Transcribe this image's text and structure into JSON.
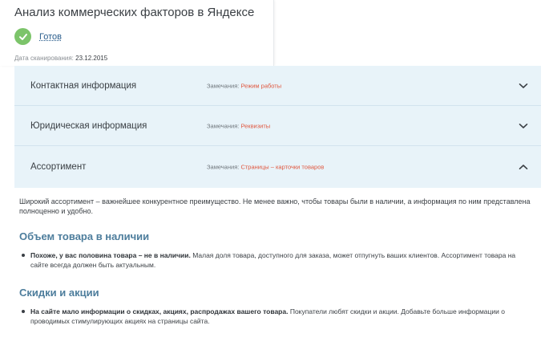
{
  "header": {
    "title": "Анализ коммерческих факторов в Яндексе",
    "status_label": "Готов",
    "status_icon": "check-circle-icon",
    "status_color": "#7cc46a",
    "scan_date_label": "Дата сканирования:",
    "scan_date_value": "23.12.2015"
  },
  "accordion": {
    "items": [
      {
        "label": "Контактная информация",
        "notes_label": "Замечания:",
        "notes_value": "Режим работы",
        "state": "collapsed",
        "chevron_icon": "chevron-down-icon"
      },
      {
        "label": "Юридическая информация",
        "notes_label": "Замечания:",
        "notes_value": "Реквизиты",
        "state": "collapsed",
        "chevron_icon": "chevron-down-icon"
      },
      {
        "label": "Ассортимент",
        "notes_label": "Замечания:",
        "notes_value": "Страницы – карточки товаров",
        "state": "expanded",
        "chevron_icon": "chevron-up-icon"
      }
    ]
  },
  "content": {
    "intro": "Широкий ассортимент – важнейшее конкурентное преимущество. Не менее важно, чтобы товары были в наличии, а информация по ним представлена полноценно и удобно.",
    "sections": [
      {
        "title": "Объем товара в наличии",
        "bullet_bold": "Похоже, у вас половина товара – не в наличии.",
        "bullet_text": " Малая доля товара, доступного для заказа, может отпугнуть ваших клиентов. Ассортимент товара на сайте всегда должен быть актуальным."
      },
      {
        "title": "Скидки и акции",
        "bullet_bold": "На сайте мало информации о скидках, акциях, распродажах вашего товара.",
        "bullet_text": " Покупатели любят скидки и акции. Добавьте больше информации о проводимых стимулирующих акциях на страницы сайта."
      }
    ]
  },
  "colors": {
    "accordion_bg": "#e8f3f9",
    "note_highlight": "#e0573f",
    "section_title": "#4d7d9c",
    "link": "#2a5d8c"
  }
}
